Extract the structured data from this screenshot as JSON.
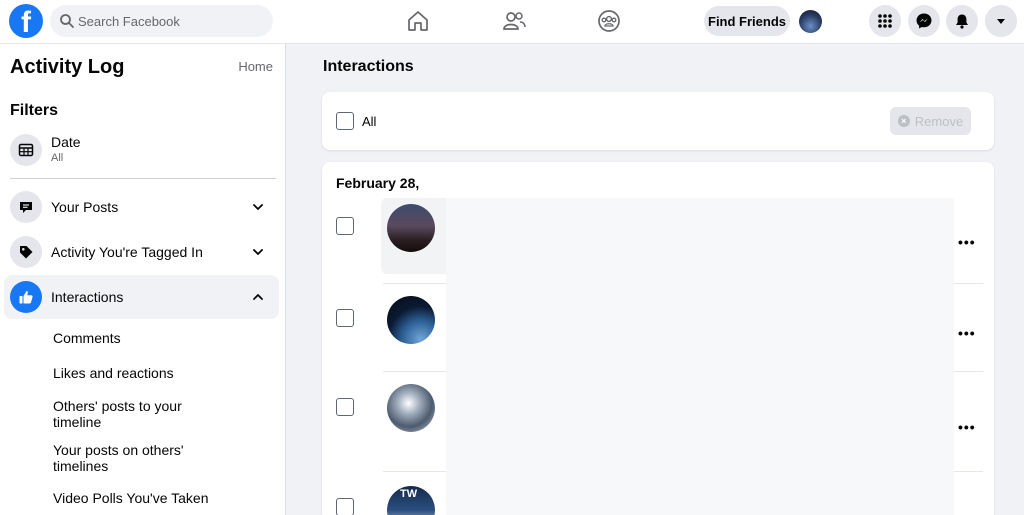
{
  "topbar": {
    "search_placeholder": "Search Facebook",
    "find_friends_label": "Find Friends",
    "icons": [
      "facebook-logo-icon",
      "search-icon",
      "home-icon",
      "friends-icon",
      "groups-icon",
      "menu-grid-icon",
      "messenger-icon",
      "notifications-bell-icon",
      "account-caret-icon"
    ]
  },
  "sidebar": {
    "title": "Activity Log",
    "home_link": "Home",
    "filters_heading": "Filters",
    "date": {
      "label": "Date",
      "value": "All"
    },
    "items": [
      {
        "label": "Your Posts",
        "icon": "post-bubble-icon",
        "expanded": false
      },
      {
        "label": "Activity You're Tagged In",
        "icon": "tag-icon",
        "expanded": false
      },
      {
        "label": "Interactions",
        "icon": "like-thumb-icon",
        "expanded": true
      }
    ],
    "sub_items": [
      "Comments",
      "Likes and reactions",
      "Others' posts to your timeline",
      "Your posts on others' timelines",
      "Video Polls You've Taken"
    ]
  },
  "main": {
    "title": "Interactions",
    "select_all_label": "All",
    "remove_label": "Remove",
    "date_heading": "February 28,",
    "more_label": "•••",
    "thumb_badge": "TW"
  },
  "colors": {
    "brand_blue": "#1877f2",
    "page_bg": "#f0f2f5",
    "secondary_text": "#65676b",
    "disabled_text": "#bcc0c4"
  }
}
